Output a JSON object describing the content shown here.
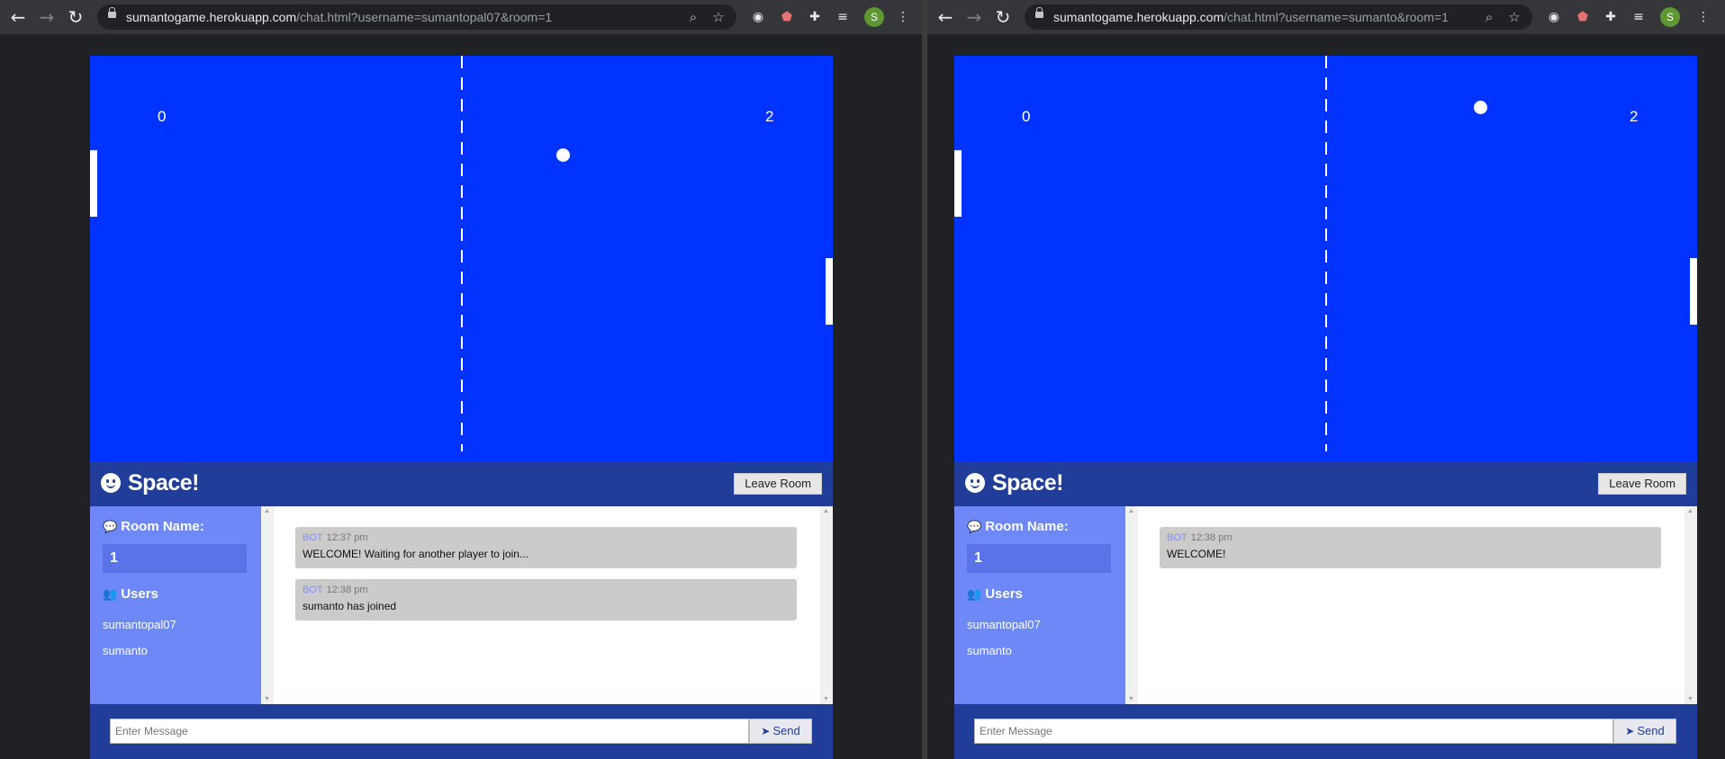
{
  "windows": [
    {
      "url_host": "sumantogame.herokuapp.com",
      "url_path": "/chat.html?username=sumantopal07&room=1",
      "avatar_letter": "S",
      "game": {
        "score_left": "0",
        "score_right": "2"
      },
      "header": {
        "brand": "Space!",
        "leave_label": "Leave Room"
      },
      "sidebar": {
        "room_heading": "Room Name:",
        "room_name": "1",
        "users_heading": "Users",
        "users": [
          "sumantopal07",
          "sumanto"
        ]
      },
      "messages": [
        {
          "author": "BOT",
          "time": "12:37 pm",
          "text": "WELCOME! Waiting for another player to join..."
        },
        {
          "author": "BOT",
          "time": "12:38 pm",
          "text": "sumanto has joined"
        }
      ],
      "input": {
        "placeholder": "Enter Message",
        "send_label": "Send"
      }
    },
    {
      "url_host": "sumantogame.herokuapp.com",
      "url_path": "/chat.html?username=sumanto&room=1",
      "avatar_letter": "S",
      "game": {
        "score_left": "0",
        "score_right": "2"
      },
      "header": {
        "brand": "Space!",
        "leave_label": "Leave Room"
      },
      "sidebar": {
        "room_heading": "Room Name:",
        "room_name": "1",
        "users_heading": "Users",
        "users": [
          "sumantopal07",
          "sumanto"
        ]
      },
      "messages": [
        {
          "author": "BOT",
          "time": "12:38 pm",
          "text": "WELCOME!"
        }
      ],
      "input": {
        "placeholder": "Enter Message",
        "send_label": "Send"
      }
    }
  ],
  "colors": {
    "game_bg": "#0033ff",
    "header_bg": "#1f3d99",
    "sidebar_bg": "#6e88f7"
  }
}
